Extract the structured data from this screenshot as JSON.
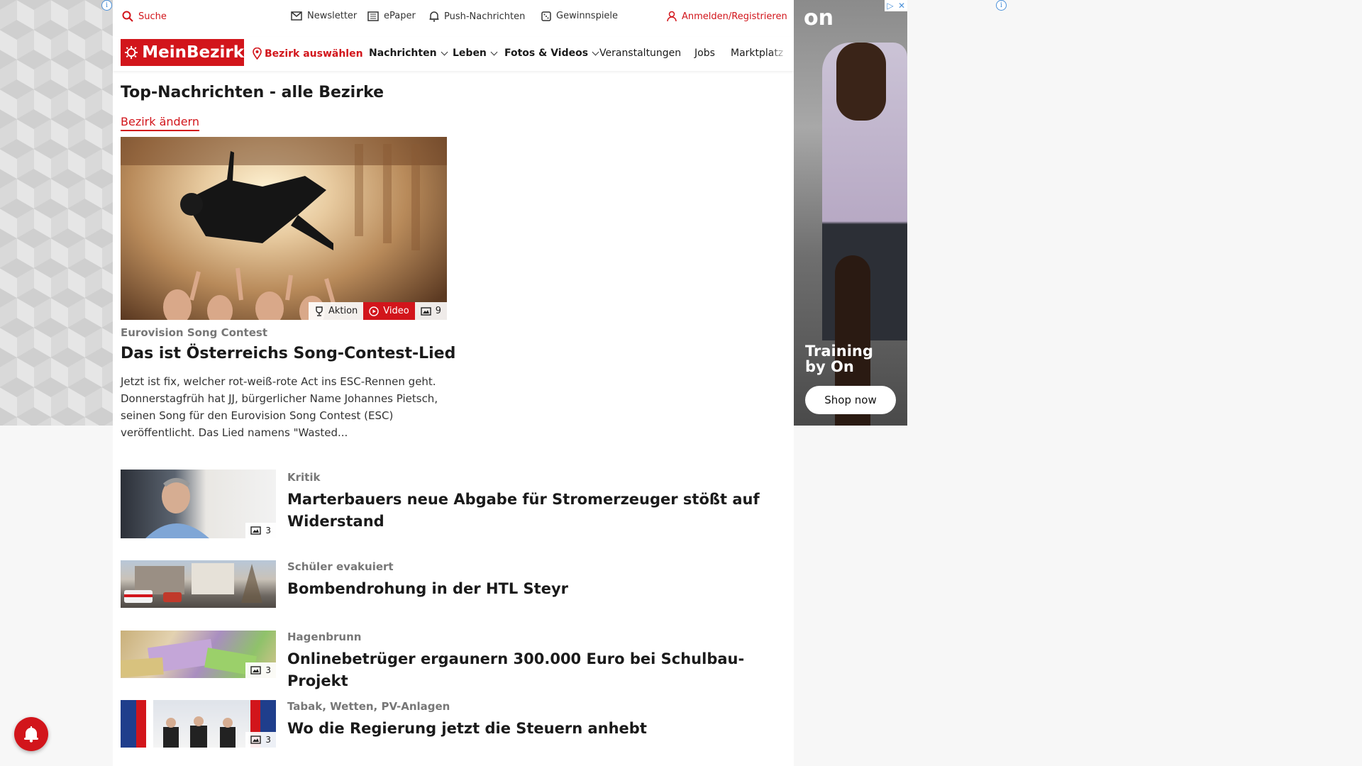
{
  "colors": {
    "brand_red": "#d2151b"
  },
  "topbar": {
    "search": "Suche",
    "newsletter": "Newsletter",
    "epaper": "ePaper",
    "push": "Push-Nachrichten",
    "games": "Gewinnspiele",
    "login": "Anmelden/Registrieren"
  },
  "nav": {
    "logo": "MeinBezirk",
    "district": "Bezirk auswählen",
    "items": [
      "Nachrichten",
      "Leben",
      "Fotos & Videos",
      "Veranstaltungen",
      "Jobs",
      "Marktplatz"
    ]
  },
  "page": {
    "title": "Top-Nachrichten - alle Bezirke",
    "change_link": "Bezirk ändern"
  },
  "hero": {
    "badges": {
      "action": "Aktion",
      "video": "Video",
      "count": "9"
    },
    "kicker": "Eurovision Song Contest",
    "title": "Das ist Österreichs Song-Contest-Lied",
    "teaser": "Jetzt ist fix, welcher rot-weiß-rote Act ins ESC-Rennen geht. Donnerstagfrüh hat JJ, bürgerlicher Name Johannes Pietsch, seinen Song für den Eurovision Song Contest (ESC) veröffentlicht. Das Lied namens \"Wasted..."
  },
  "articles": [
    {
      "kicker": "Kritik",
      "title": "Marterbauers neue Abgabe für Stromerzeuger stößt auf Widerstand",
      "count": "3"
    },
    {
      "kicker": "Schüler evakuiert",
      "title": "Bombendrohung in der HTL Steyr",
      "count": ""
    },
    {
      "kicker": "Hagenbrunn",
      "title": "Onlinebetrüger ergaunern 300.000 Euro bei Schulbau-Projekt",
      "count": "3"
    },
    {
      "kicker": "Tabak, Wetten, PV-Anlagen",
      "title": "Wo die Regierung jetzt die Steuern anhebt",
      "count": "3"
    }
  ],
  "ad": {
    "brand": "on",
    "headline": "Training by On",
    "cta": "Shop now"
  }
}
